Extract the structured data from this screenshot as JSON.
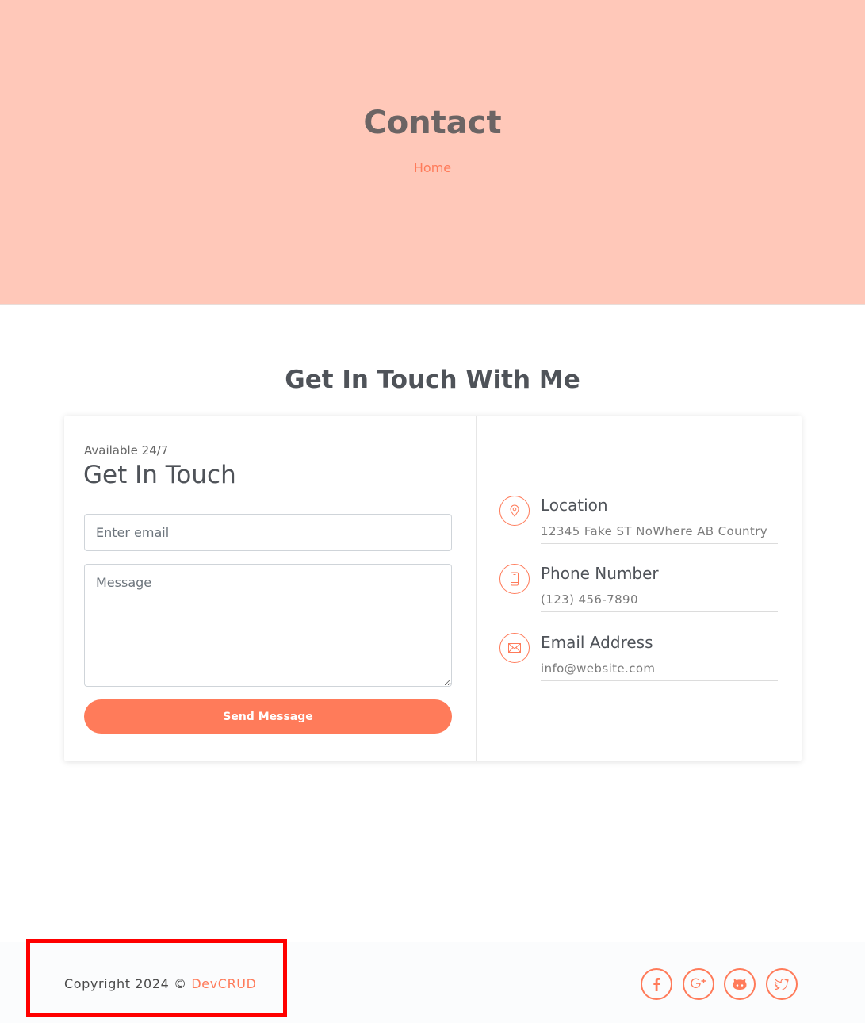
{
  "hero": {
    "title": "Contact",
    "breadcrumb": "Home"
  },
  "section": {
    "title": "Get In Touch With Me"
  },
  "form": {
    "eyebrow": "Available 24/7",
    "title": "Get In Touch",
    "email_placeholder": "Enter email",
    "message_placeholder": "Message",
    "submit_label": "Send Message"
  },
  "info": [
    {
      "label": "Location",
      "value": "12345 Fake ST NoWhere AB Country",
      "icon": "location-pin-icon"
    },
    {
      "label": "Phone Number",
      "value": "(123) 456-7890",
      "icon": "phone-icon"
    },
    {
      "label": "Email Address",
      "value": "info@website.com",
      "icon": "envelope-icon"
    }
  ],
  "footer": {
    "copyright_prefix": "Copyright 2024 © ",
    "brand": "DevCRUD",
    "social": [
      "facebook-icon",
      "google-plus-icon",
      "github-icon",
      "twitter-icon"
    ]
  },
  "colors": {
    "accent": "#ff7b5a",
    "hero_bg": "#ffc8b9",
    "highlight": "#ff0000"
  }
}
